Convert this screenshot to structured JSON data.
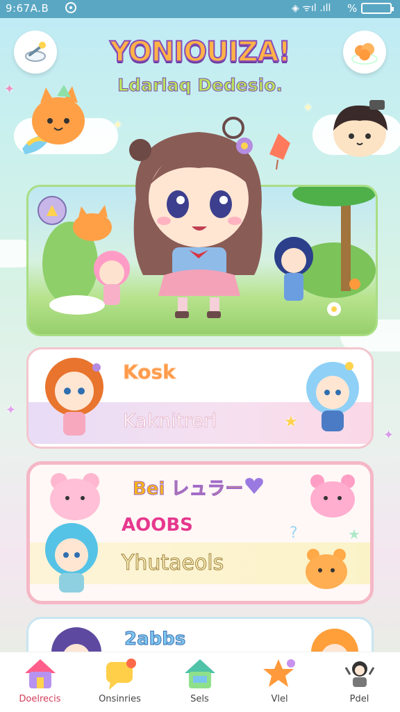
{
  "status_bar": {
    "time": "9:67A.B",
    "signal": "◈ ᯤıl .ıll",
    "percent": "%"
  },
  "header": {
    "title": "YONIOUIZA!",
    "subtitle": "Ldarlaq Dedesio."
  },
  "hero": {
    "name": "hero-character-scene"
  },
  "menu_cards": [
    {
      "label_top": "Kosk",
      "label_main": "Kaknitrerl"
    },
    {
      "label_top": "Bei レュラー",
      "label_mid": "AOOBS",
      "label_main": "Yhutaeols"
    },
    {
      "label_top": "2abbs"
    }
  ],
  "nav": [
    {
      "label": "Doelrecis",
      "icon": "home-icon",
      "active": true
    },
    {
      "label": "Onsinries",
      "icon": "chat-icon",
      "active": false
    },
    {
      "label": "Sels",
      "icon": "house-icon",
      "active": false
    },
    {
      "label": "Vlel",
      "icon": "star-icon",
      "active": false
    },
    {
      "label": "Pdel",
      "icon": "profile-icon",
      "active": false
    }
  ],
  "colors": {
    "accent": "#d23c5a",
    "card_border_pink": "#f5b7c6",
    "grass": "#97cf6c",
    "status_bar": "#5aa7c3"
  }
}
